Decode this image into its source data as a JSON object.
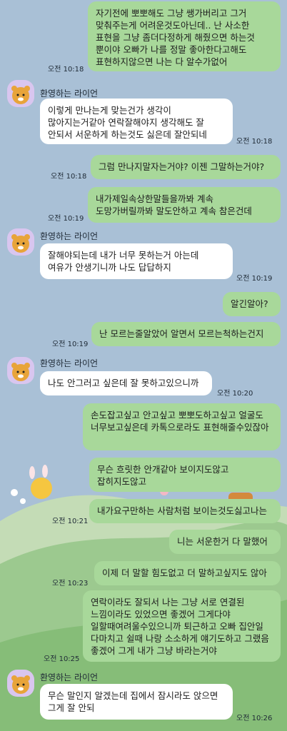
{
  "sender_name": "환영하는 라이언",
  "messages": [
    {
      "side": "me",
      "text": "자기전에 뽀뽀해도 그냥 쌩가버리고 그거 맞춰주는게 어려운것도아닌데.. 난 사소한 표현을 그냥 좀더다정하게 해줬으면 하는것 뿐이야 오빠가 나를 정말 좋아한다고해도 표현하지않으면 나는 다 알수가없어",
      "time": "오전 10:18"
    },
    {
      "side": "you",
      "text": "이렇게 만나는게 맞는건가 생각이 많아지는거같아 연락잘해야지 생각해도 잘 안되서 서운하게 하는것도 싫은데 잘안되네",
      "time": "오전 10:18"
    },
    {
      "side": "me",
      "text": "그럼 만나지말자는거야? 이젠 그말하는거야?",
      "time": "오전 10:18"
    },
    {
      "side": "me",
      "text": "내가제일속상한말들을까봐 계속 도망가버릴까봐 말도안하고 계속 참은건데",
      "time": "오전 10:19"
    },
    {
      "side": "you",
      "text": "잘해야되는데 내가 너무 못하는거 아는데 여유가 안생기니까 나도 답답하지",
      "time": "오전 10:19"
    },
    {
      "side": "me",
      "text": "알긴알아?",
      "time": ""
    },
    {
      "side": "me",
      "text": "난 모르는줄알았어 알면서 모르는척하는건지",
      "time": "오전 10:19"
    },
    {
      "side": "you",
      "text": "나도 안그러고 싶은데 잘 못하고있으니까",
      "time": "오전 10:20"
    },
    {
      "side": "me",
      "text": "손도잡고싶고 안고싶고 뽀뽀도하고싶고 얼굴도 너무보고싶은데 카톡으로라도 표현해줄수있잖아",
      "time": ""
    },
    {
      "side": "me",
      "text": "무슨 흐릿한 안개같아 보이지도않고 잡히지도않고",
      "time": ""
    },
    {
      "side": "me",
      "text": "내가요구만하는 사람처럼 보이는것도싫고나는",
      "time": "오전 10:21"
    },
    {
      "side": "me",
      "text": "니는 서운한거 다 말했어",
      "time": ""
    },
    {
      "side": "me",
      "text": "이제 더 말할 힘도없고 더 말하고싶지도 않아",
      "time": "오전 10:23"
    },
    {
      "side": "me",
      "text": "연락이라도 잘되서 나는 그냥 서로 연결된 느낌이라도 있었으면 좋겠어 그게다야 일할때여려울수있으니까 퇴근하고 오빠 집안일 다마치고 쉴때 나랑 소소하게 얘기도하고 그랬음 좋겠어 그게 내가 그냥 바라는거야",
      "time": "오전 10:25"
    },
    {
      "side": "you",
      "text": "무슨 말인지 알겠는데 집에서 잠시라도 앉으면 그게 잘 안되",
      "time": "오전 10:26"
    }
  ],
  "colors": {
    "background": "#a9c0d6",
    "my_bubble": "#a8d89a",
    "their_bubble": "#ffffff"
  },
  "icons": {
    "avatar": "ryan-avatar-icon"
  }
}
